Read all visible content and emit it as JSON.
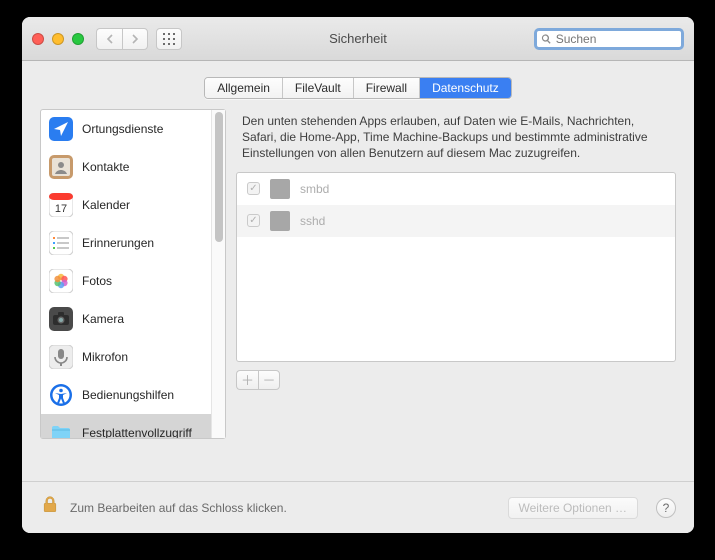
{
  "window": {
    "title": "Sicherheit"
  },
  "search": {
    "placeholder": "Suchen"
  },
  "tabs": [
    {
      "label": "Allgemein",
      "active": false
    },
    {
      "label": "FileVault",
      "active": false
    },
    {
      "label": "Firewall",
      "active": false
    },
    {
      "label": "Datenschutz",
      "active": true
    }
  ],
  "sidebar": {
    "items": [
      {
        "label": "Ortungsdienste",
        "icon": "location"
      },
      {
        "label": "Kontakte",
        "icon": "contacts"
      },
      {
        "label": "Kalender",
        "icon": "calendar"
      },
      {
        "label": "Erinnerungen",
        "icon": "reminders"
      },
      {
        "label": "Fotos",
        "icon": "photos"
      },
      {
        "label": "Kamera",
        "icon": "camera"
      },
      {
        "label": "Mikrofon",
        "icon": "microphone"
      },
      {
        "label": "Bedienungshilfen",
        "icon": "accessibility"
      },
      {
        "label": "Festplattenvollzugriff",
        "icon": "folder",
        "selected": true
      }
    ]
  },
  "main": {
    "description": "Den unten stehenden Apps erlauben, auf Daten wie E-Mails, Nachrichten, Safari, die Home-App, Time Machine-Backups und bestimmte administrative Einstellungen von allen Benutzern auf diesem Mac zuzugreifen.",
    "apps": [
      {
        "name": "smbd",
        "checked": true
      },
      {
        "name": "sshd",
        "checked": true
      }
    ]
  },
  "footer": {
    "lock_text": "Zum Bearbeiten auf das Schloss klicken.",
    "more_label": "Weitere Optionen …"
  },
  "calendar_day": "17"
}
